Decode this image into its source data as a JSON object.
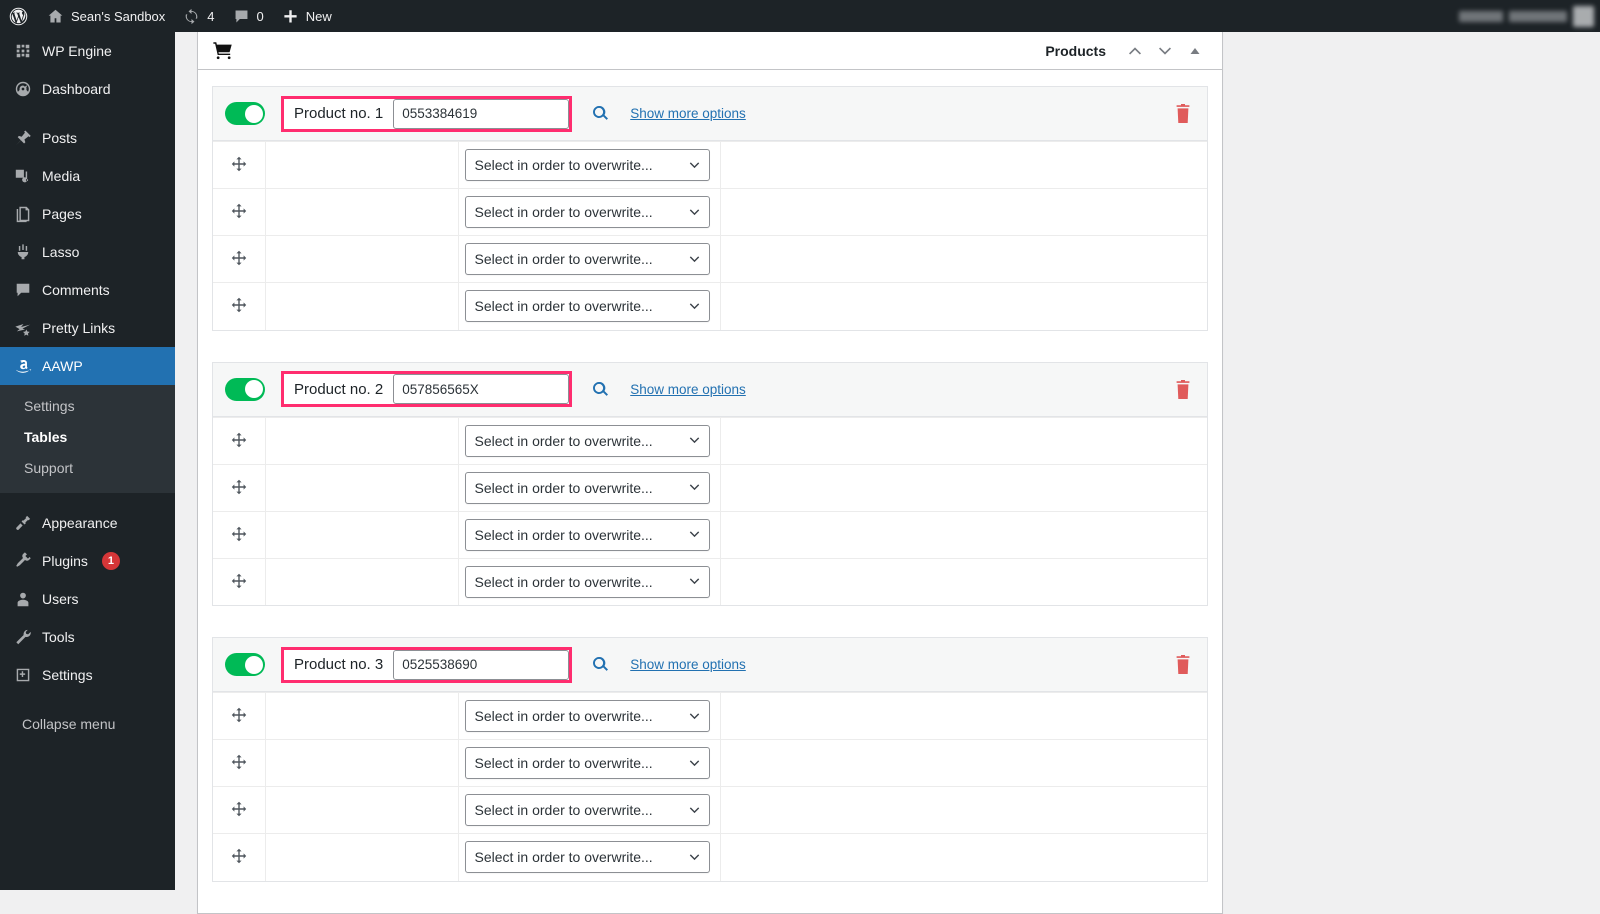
{
  "adminbar": {
    "site_title": "Sean's Sandbox",
    "updates_count": "4",
    "comments_count": "0",
    "new_label": "New",
    "icons": [
      "wordpress-logo-icon",
      "home-icon",
      "updates-icon",
      "comment-icon",
      "plus-icon"
    ]
  },
  "sidebar": {
    "items": [
      {
        "label": "WP Engine",
        "icon": "wpengine-icon",
        "current": false
      },
      {
        "label": "Dashboard",
        "icon": "dashboard-icon",
        "current": false
      },
      {
        "label": "Posts",
        "icon": "pin-icon",
        "current": false
      },
      {
        "label": "Media",
        "icon": "media-icon",
        "current": false
      },
      {
        "label": "Pages",
        "icon": "pages-icon",
        "current": false
      },
      {
        "label": "Lasso",
        "icon": "lasso-icon",
        "current": false
      },
      {
        "label": "Comments",
        "icon": "comments-icon",
        "current": false
      },
      {
        "label": "Pretty Links",
        "icon": "pretty-links-icon",
        "current": false
      },
      {
        "label": "AAWP",
        "icon": "amazon-icon",
        "current": true
      },
      {
        "label": "Appearance",
        "icon": "appearance-icon",
        "current": false
      },
      {
        "label": "Plugins",
        "icon": "plugins-icon",
        "current": false,
        "badge": "1"
      },
      {
        "label": "Users",
        "icon": "users-icon",
        "current": false
      },
      {
        "label": "Tools",
        "icon": "tools-icon",
        "current": false
      },
      {
        "label": "Settings",
        "icon": "settings-icon",
        "current": false
      }
    ],
    "submenu": [
      {
        "label": "Settings",
        "current": false
      },
      {
        "label": "Tables",
        "current": true
      },
      {
        "label": "Support",
        "current": false
      }
    ],
    "collapse_label": "Collapse menu",
    "accent_current": "#2271b1",
    "badge_color": "#d63638"
  },
  "panel": {
    "title": "Products",
    "cart_icon": "shopping-cart-icon",
    "controls": [
      "move-up-icon",
      "move-down-icon",
      "toggle-panel-icon"
    ]
  },
  "select_placeholder": "Select in order to overwrite...",
  "colors": {
    "highlight_border": "#ff2d6f",
    "toggle_on": "#00ba56",
    "link": "#2271b1",
    "trash": "#e05b5b"
  },
  "products": [
    {
      "label": "Product no. 1",
      "value": "0553384619",
      "enabled": true,
      "search_icon": "search-icon",
      "more_options_label": "Show more options",
      "delete_icon": "trash-icon",
      "rows": [
        {
          "handle_icon": "move-handle-icon",
          "select": "Select in order to overwrite..."
        },
        {
          "handle_icon": "move-handle-icon",
          "select": "Select in order to overwrite..."
        },
        {
          "handle_icon": "move-handle-icon",
          "select": "Select in order to overwrite..."
        },
        {
          "handle_icon": "move-handle-icon",
          "select": "Select in order to overwrite..."
        }
      ]
    },
    {
      "label": "Product no. 2",
      "value": "057856565X",
      "enabled": true,
      "search_icon": "search-icon",
      "more_options_label": "Show more options",
      "delete_icon": "trash-icon",
      "rows": [
        {
          "handle_icon": "move-handle-icon",
          "select": "Select in order to overwrite..."
        },
        {
          "handle_icon": "move-handle-icon",
          "select": "Select in order to overwrite..."
        },
        {
          "handle_icon": "move-handle-icon",
          "select": "Select in order to overwrite..."
        },
        {
          "handle_icon": "move-handle-icon",
          "select": "Select in order to overwrite..."
        }
      ]
    },
    {
      "label": "Product no. 3",
      "value": "0525538690",
      "enabled": true,
      "search_icon": "search-icon",
      "more_options_label": "Show more options",
      "delete_icon": "trash-icon",
      "rows": [
        {
          "handle_icon": "move-handle-icon",
          "select": "Select in order to overwrite..."
        },
        {
          "handle_icon": "move-handle-icon",
          "select": "Select in order to overwrite..."
        },
        {
          "handle_icon": "move-handle-icon",
          "select": "Select in order to overwrite..."
        },
        {
          "handle_icon": "move-handle-icon",
          "select": "Select in order to overwrite..."
        }
      ]
    }
  ]
}
